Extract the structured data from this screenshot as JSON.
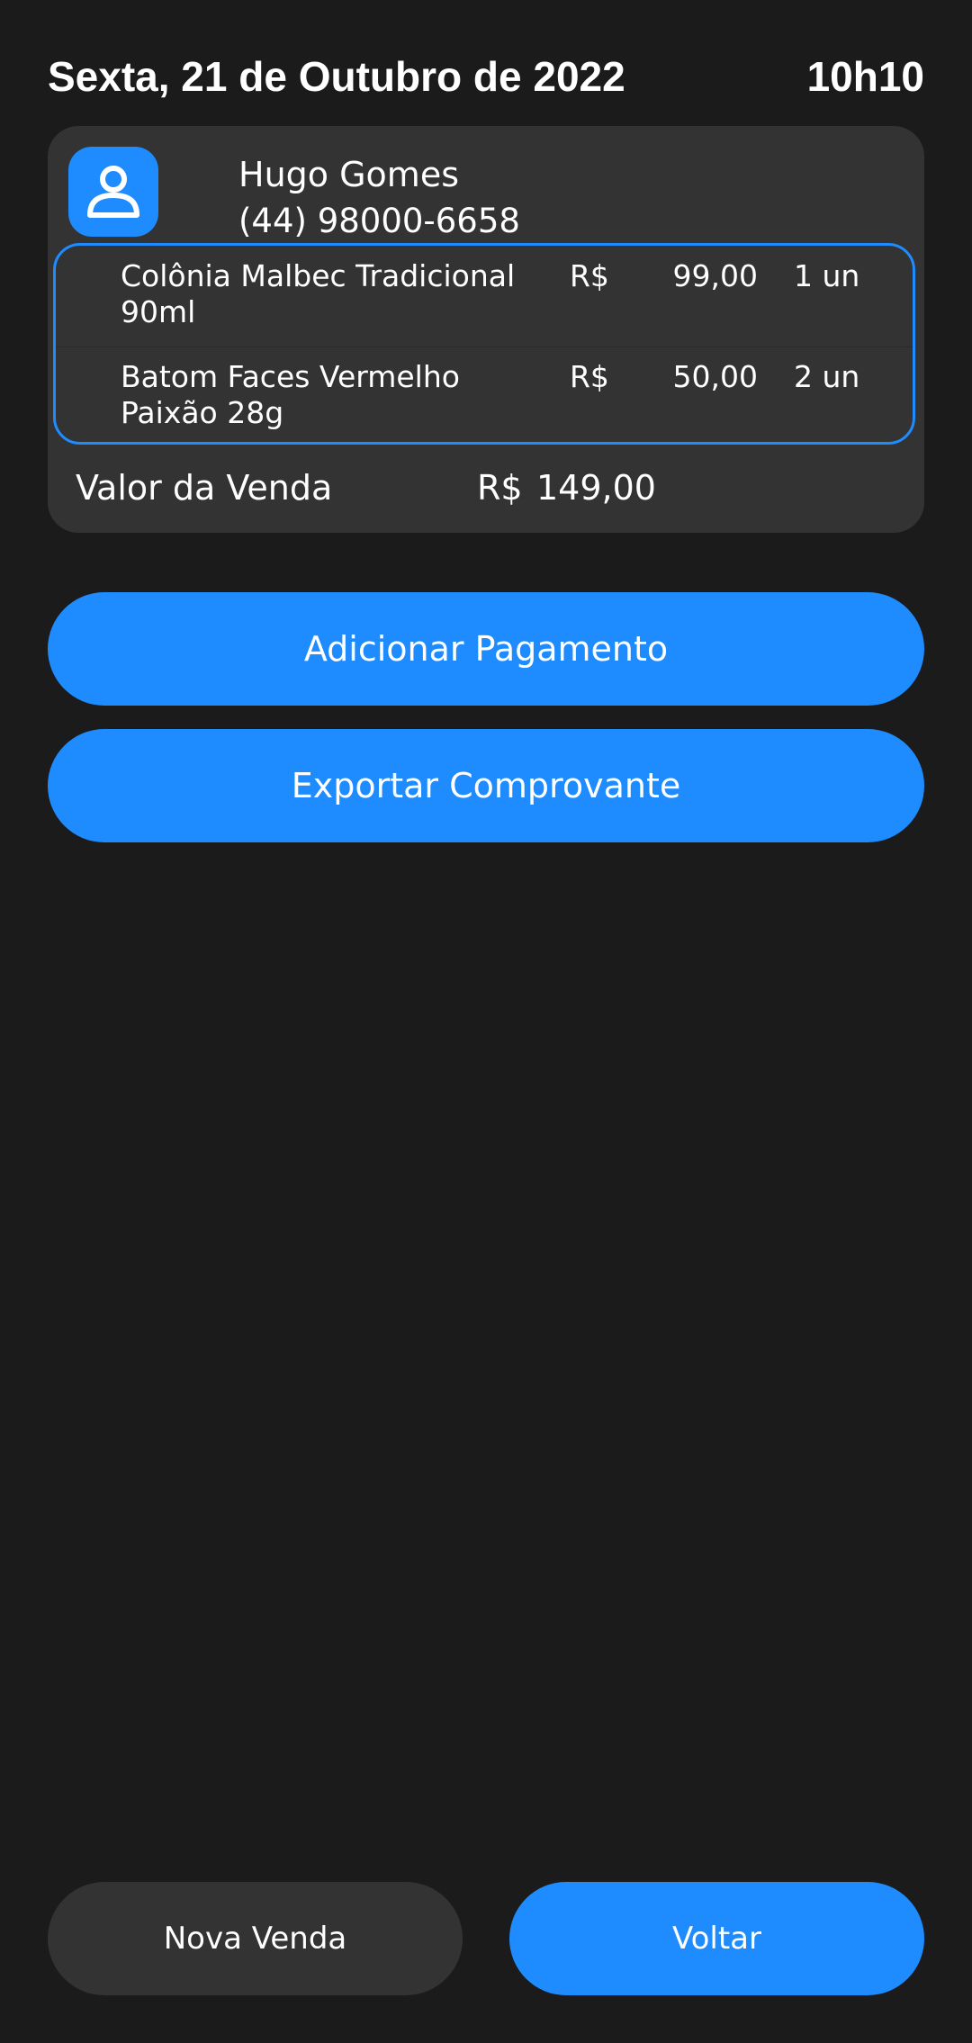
{
  "header": {
    "date": "Sexta, 21 de Outubro de 2022",
    "time": "10h10"
  },
  "customer": {
    "icon": "user-icon",
    "name": "Hugo Gomes",
    "phone": "(44) 98000-6658"
  },
  "items": [
    {
      "name": "Colônia Malbec Tradicional 90ml",
      "currency": "R$",
      "price": "99,00",
      "quantity": "1 un"
    },
    {
      "name": "Batom Faces Vermelho Paixão 28g",
      "currency": "R$",
      "price": "50,00",
      "quantity": "2 un"
    }
  ],
  "total": {
    "label": "Valor da Venda",
    "currency": "R$",
    "value": "149,00"
  },
  "actions": {
    "add_payment": "Adicionar Pagamento",
    "export_receipt": "Exportar Comprovante",
    "new_sale": "Nova Venda",
    "back": "Voltar"
  },
  "colors": {
    "background": "#1b1b1b",
    "card": "#333333",
    "accent": "#1e8cfe"
  }
}
